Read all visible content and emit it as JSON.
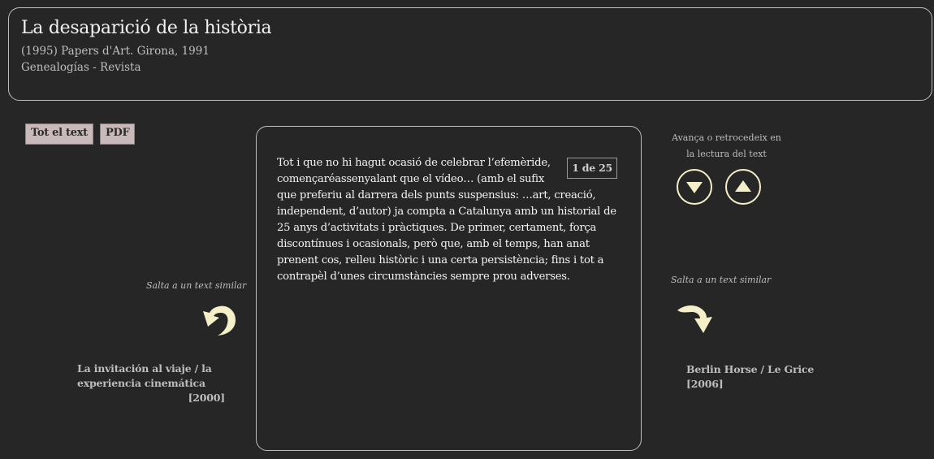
{
  "header": {
    "title": "La desaparició de la història",
    "subtitle": "(1995) Papers d'Art. Girona, 1991",
    "series": "Genealogías - Revista"
  },
  "toolbar": {
    "fulltext_label": "Tot el text",
    "pdf_label": "PDF"
  },
  "reader": {
    "page_indicator": "1 de 25",
    "text": "Tot i que no hi hagut ocasió de celebrar l’efemèride, començaréassenyalant que el vídeo… (amb el sufix que preferiu al darrera dels punts suspensius: …art, creació, independent, d’autor) ja compta a Catalunya amb un historial de 25 anys d’activitats i pràctiques. De primer, certament, força discontínues i ocasionals, però que, amb el temps, han anat prenent cos, relleu històric i una certa persistència; fins i tot a contrapèl d’unes circumstàncies sempre prou adverses."
  },
  "navigation": {
    "hint": "Avança o retrocedeix en la lectura del text",
    "down_icon": "arrow-down-icon",
    "up_icon": "arrow-up-icon"
  },
  "similar_left": {
    "label": "Salta a un text similar",
    "icon": "curved-arrow-left-icon",
    "title": "La invitación al viaje / la experiencia cinemática",
    "year": "[2000]"
  },
  "similar_right": {
    "label": "Salta a un text similar",
    "icon": "curved-arrow-right-icon",
    "title": "Berlin Horse / Le Grice",
    "year": "[2006]"
  },
  "colors": {
    "background": "#262626",
    "button_bg": "#c9b9bb",
    "accent_icon": "#f4efc8"
  }
}
